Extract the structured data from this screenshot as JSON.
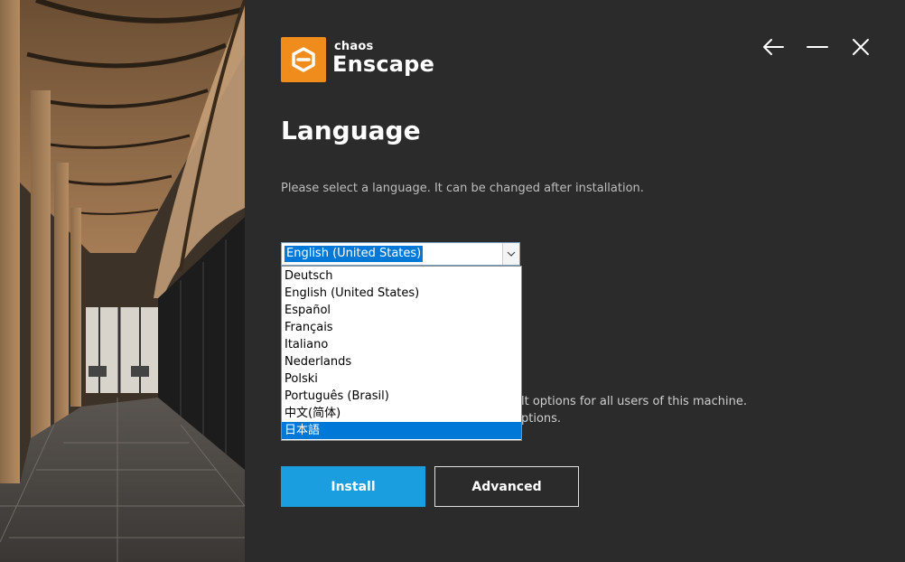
{
  "header": {
    "brand_small": "chaos",
    "brand_large": "Enscape",
    "logo_color": "#f08c1b"
  },
  "window_controls": {
    "back_icon": "arrow-left-icon",
    "minimize_icon": "minimize-icon",
    "close_icon": "close-icon"
  },
  "page": {
    "title": "Language",
    "description": "Please select a language. It can be changed after installation.",
    "obscured_line1": "lt options for all users of this machine.",
    "obscured_line2": "ptions."
  },
  "language_select": {
    "selected": "English (United States)",
    "options": [
      "Deutsch",
      "English (United States)",
      "Español",
      "Français",
      "Italiano",
      "Nederlands",
      "Polski",
      "Português (Brasil)",
      "中文(简体)",
      "日本語"
    ],
    "highlighted_option": "日本語"
  },
  "buttons": {
    "install": "Install",
    "advanced": "Advanced"
  },
  "colors": {
    "background": "#2b2b2b",
    "accent": "#1a9ee0",
    "selection": "#0078d7"
  }
}
